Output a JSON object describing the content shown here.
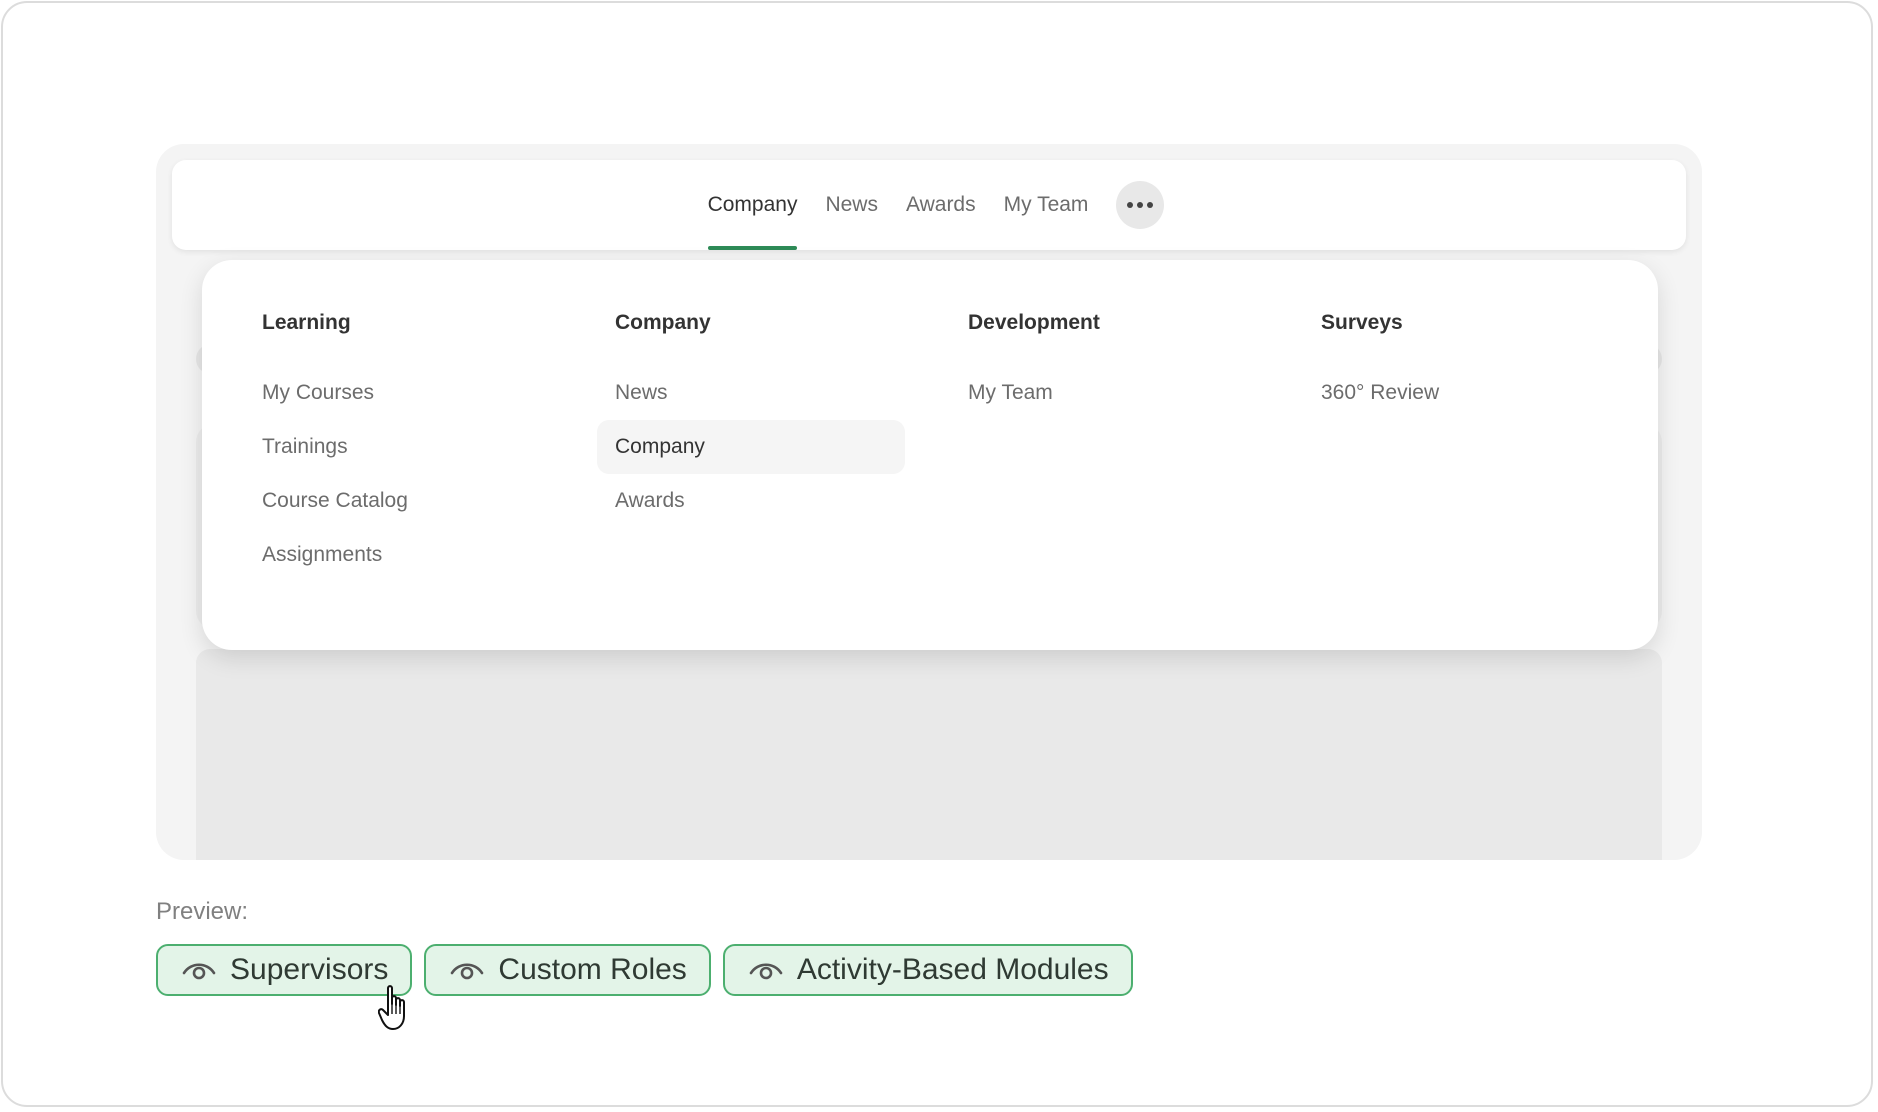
{
  "navbar": {
    "items": [
      {
        "label": "Company",
        "active": true
      },
      {
        "label": "News",
        "active": false
      },
      {
        "label": "Awards",
        "active": false
      },
      {
        "label": "My Team",
        "active": false
      }
    ],
    "more_icon": "ellipsis-icon"
  },
  "dropdown": {
    "columns": [
      {
        "heading": "Learning",
        "items": [
          "My Courses",
          "Trainings",
          "Course Catalog",
          "Assignments"
        ]
      },
      {
        "heading": "Company",
        "items": [
          "News",
          "Company",
          "Awards"
        ],
        "highlighted": "Company"
      },
      {
        "heading": "Development",
        "items": [
          "My Team"
        ]
      },
      {
        "heading": "Surveys",
        "items": [
          "360° Review"
        ]
      }
    ]
  },
  "preview": {
    "label": "Preview:",
    "chips": [
      {
        "label": "Supervisors",
        "icon": "eye-icon"
      },
      {
        "label": "Custom Roles",
        "icon": "eye-icon"
      },
      {
        "label": "Activity-Based Modules",
        "icon": "eye-icon"
      }
    ]
  },
  "colors": {
    "accent": "#2e8b57",
    "chip_border": "#4caf6f",
    "chip_bg": "#e3f4e8"
  }
}
